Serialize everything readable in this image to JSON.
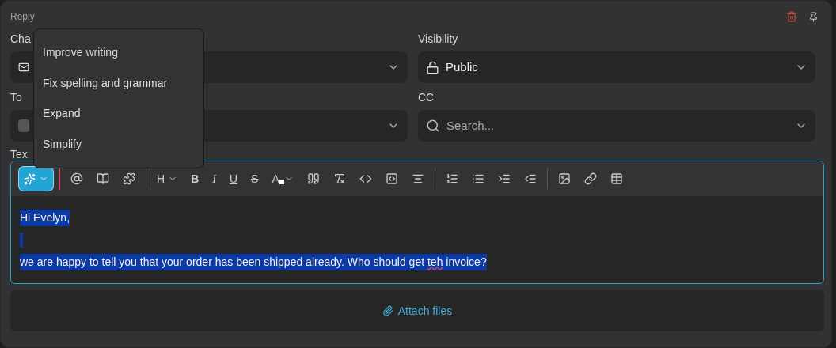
{
  "panel": {
    "title": "Reply"
  },
  "fields": [
    {
      "label": "Cha",
      "kind": "select"
    },
    {
      "label": "Visibility",
      "kind": "select",
      "value": "Public"
    },
    {
      "label": "To",
      "kind": "recipients"
    },
    {
      "label": "CC",
      "kind": "search",
      "placeholder": "Search..."
    }
  ],
  "editor": {
    "label": "Tex",
    "ai_button": {
      "active": true
    },
    "toolbar_letters": [
      "H",
      "B",
      "I",
      "U",
      "S",
      "A"
    ],
    "paragraphs": [
      {
        "selected": true,
        "segments": [
          {
            "text": "Hi Evelyn,",
            "misspelled": false
          }
        ]
      },
      {
        "selected": true
      },
      {
        "selected": true,
        "segments": [
          {
            "text": "we are happy to tell you that your order has been shipped already. Who should get ",
            "misspelled": false
          },
          {
            "text": "teh",
            "misspelled": true
          },
          {
            "text": " invoice?",
            "misspelled": false
          }
        ]
      }
    ]
  },
  "attach": {
    "label": "Attach files"
  },
  "ai_menu": {
    "items": [
      {
        "label": "Improve writing"
      },
      {
        "label": "Fix spelling and grammar"
      },
      {
        "label": "Expand"
      },
      {
        "label": "Simplify"
      }
    ]
  }
}
